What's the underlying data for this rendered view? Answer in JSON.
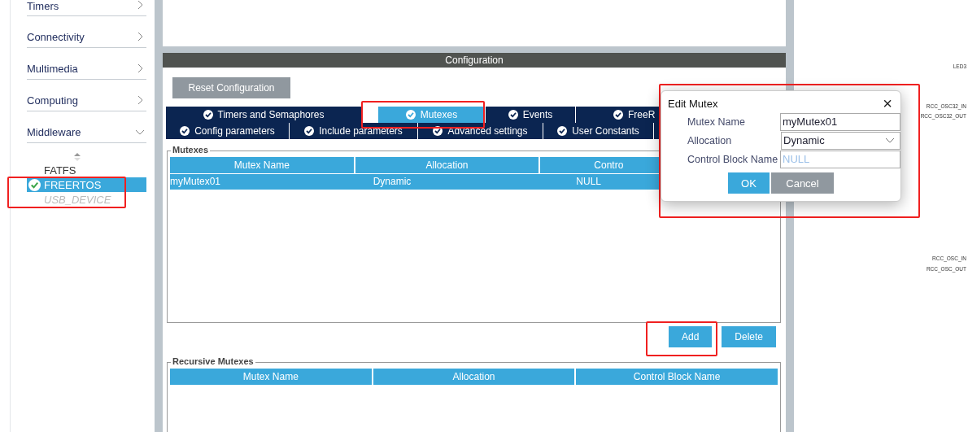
{
  "sidebar": {
    "categories": [
      {
        "label": "Timers",
        "expanded": false
      },
      {
        "label": "Connectivity",
        "expanded": false
      },
      {
        "label": "Multimedia",
        "expanded": false
      },
      {
        "label": "Computing",
        "expanded": false
      },
      {
        "label": "Middleware",
        "expanded": true
      }
    ],
    "items": [
      {
        "label": "FATFS",
        "selected": false,
        "enabled": true,
        "checked": false
      },
      {
        "label": "FREERTOS",
        "selected": true,
        "enabled": true,
        "checked": true
      },
      {
        "label": "USB_DEVICE",
        "selected": false,
        "enabled": false,
        "checked": false
      }
    ]
  },
  "configuration": {
    "title": "Configuration",
    "reset_button": "Reset Configuration",
    "tab_rows": [
      [
        {
          "label": "Timers and Semaphores",
          "selected": false
        },
        {
          "label": "Mutexes",
          "selected": true
        },
        {
          "label": "Events",
          "selected": false
        },
        {
          "label": "FreeR",
          "selected": false
        }
      ],
      [
        {
          "label": "Config parameters",
          "selected": false
        },
        {
          "label": "Include parameters",
          "selected": false
        },
        {
          "label": "Advanced settings",
          "selected": false
        },
        {
          "label": "User Constants",
          "selected": false
        }
      ]
    ],
    "mutexes": {
      "title": "Mutexes",
      "columns": [
        "Mutex Name",
        "Allocation",
        "Contro"
      ],
      "rows": [
        {
          "cells": [
            "myMutex01",
            "Dynamic",
            "NULL"
          ],
          "selected": true
        }
      ],
      "buttons": [
        "Add",
        "Delete"
      ]
    },
    "recursive_mutexes": {
      "title": "Recursive Mutexes",
      "columns": [
        "Mutex Name",
        "Allocation",
        "Control Block Name"
      ]
    }
  },
  "dialog": {
    "title": "Edit Mutex",
    "close": "×",
    "fields": [
      {
        "label": "Mutex Name",
        "kind": "text",
        "value": "myMutex01"
      },
      {
        "label": "Allocation",
        "kind": "select",
        "value": "Dynamic"
      },
      {
        "label": "Control Block Name",
        "kind": "text",
        "placeholder": "NULL"
      }
    ],
    "buttons": [
      {
        "label": "OK",
        "kind": "primary"
      },
      {
        "label": "Cancel",
        "kind": "secondary"
      }
    ]
  },
  "pin_labels": [
    "LED3",
    "RCC_OSC32_IN",
    "RCC_OSC32_OUT",
    "RCC_OSC_IN",
    "RCC_OSC_OUT"
  ]
}
